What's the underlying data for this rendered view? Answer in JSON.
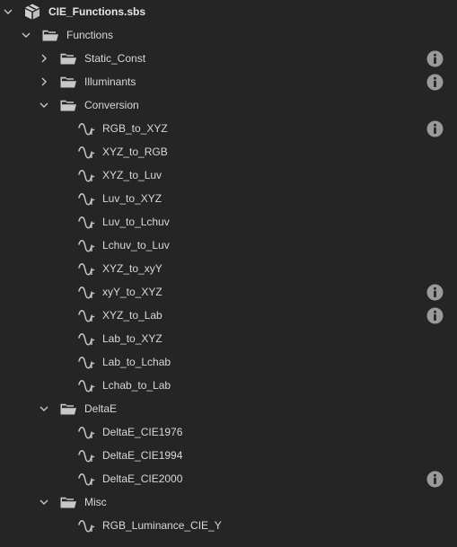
{
  "tree": {
    "root": {
      "label": "CIE_Functions.sbs",
      "icon": "package-icon",
      "expanded": true
    },
    "nodes": [
      {
        "type": "folder",
        "label": "Functions",
        "depth": 1,
        "expanded": true,
        "info": false
      },
      {
        "type": "folder",
        "label": "Static_Const",
        "depth": 2,
        "expanded": false,
        "info": true
      },
      {
        "type": "folder",
        "label": "Illuminants",
        "depth": 2,
        "expanded": false,
        "info": true
      },
      {
        "type": "folder",
        "label": "Conversion",
        "depth": 2,
        "expanded": true,
        "info": false
      },
      {
        "type": "function",
        "label": "RGB_to_XYZ",
        "depth": 3,
        "info": true
      },
      {
        "type": "function",
        "label": "XYZ_to_RGB",
        "depth": 3,
        "info": false
      },
      {
        "type": "function",
        "label": "XYZ_to_Luv",
        "depth": 3,
        "info": false
      },
      {
        "type": "function",
        "label": "Luv_to_XYZ",
        "depth": 3,
        "info": false
      },
      {
        "type": "function",
        "label": "Luv_to_Lchuv",
        "depth": 3,
        "info": false
      },
      {
        "type": "function",
        "label": "Lchuv_to_Luv",
        "depth": 3,
        "info": false
      },
      {
        "type": "function",
        "label": "XYZ_to_xyY",
        "depth": 3,
        "info": false
      },
      {
        "type": "function",
        "label": "xyY_to_XYZ",
        "depth": 3,
        "info": true
      },
      {
        "type": "function",
        "label": "XYZ_to_Lab",
        "depth": 3,
        "info": true
      },
      {
        "type": "function",
        "label": "Lab_to_XYZ",
        "depth": 3,
        "info": false
      },
      {
        "type": "function",
        "label": "Lab_to_Lchab",
        "depth": 3,
        "info": false
      },
      {
        "type": "function",
        "label": "Lchab_to_Lab",
        "depth": 3,
        "info": false
      },
      {
        "type": "folder",
        "label": "DeltaE",
        "depth": 2,
        "expanded": true,
        "info": false
      },
      {
        "type": "function",
        "label": "DeltaE_CIE1976",
        "depth": 3,
        "info": false
      },
      {
        "type": "function",
        "label": "DeltaE_CIE1994",
        "depth": 3,
        "info": false
      },
      {
        "type": "function",
        "label": "DeltaE_CIE2000",
        "depth": 3,
        "info": true
      },
      {
        "type": "folder",
        "label": "Misc",
        "depth": 2,
        "expanded": true,
        "info": false
      },
      {
        "type": "function",
        "label": "RGB_Luminance_CIE_Y",
        "depth": 3,
        "info": false
      }
    ]
  },
  "colors": {
    "background": "#252525",
    "text": "#d8d8d8",
    "icon": "#c8c8c8",
    "info_badge": "#9a9a9a"
  }
}
